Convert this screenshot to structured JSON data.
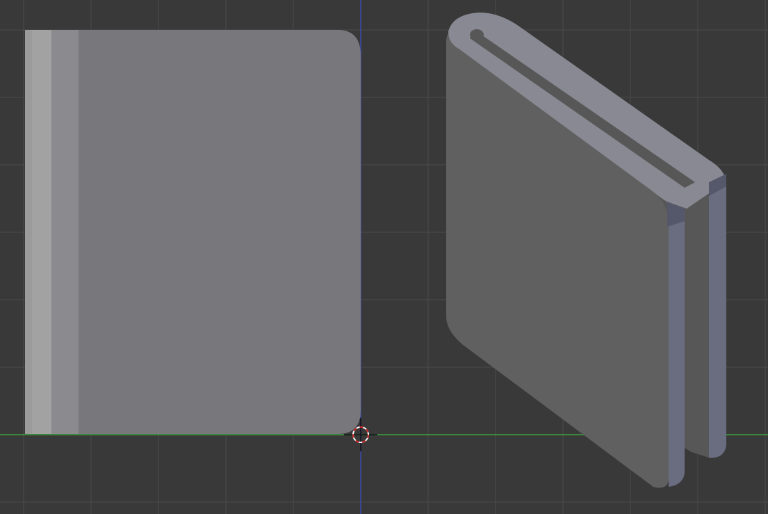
{
  "viewport": {
    "background_color": "#393939",
    "grid_line_color": "#4a4a4a",
    "x_axis_color": "#3f9d3f",
    "z_axis_color": "#3b4bb0"
  },
  "objects": [
    {
      "kind": "rounded-slab",
      "view": "orthographic-side",
      "colors": {
        "face": "#78777c",
        "spine_light": "#a2a2a2",
        "spine_mid": "#8b8a8e",
        "spine_outer": "#9b9b9b"
      }
    },
    {
      "kind": "double-slab-with-slot",
      "view": "perspective",
      "colors": {
        "front_face": "#606060",
        "top_face": "#898993",
        "edge_blue": "#6a6c80",
        "back_face": "#575757"
      }
    }
  ],
  "cursor": {
    "icon": "3d-cursor-icon",
    "ring_colors": [
      "#cc2222",
      "#ffffff"
    ]
  }
}
